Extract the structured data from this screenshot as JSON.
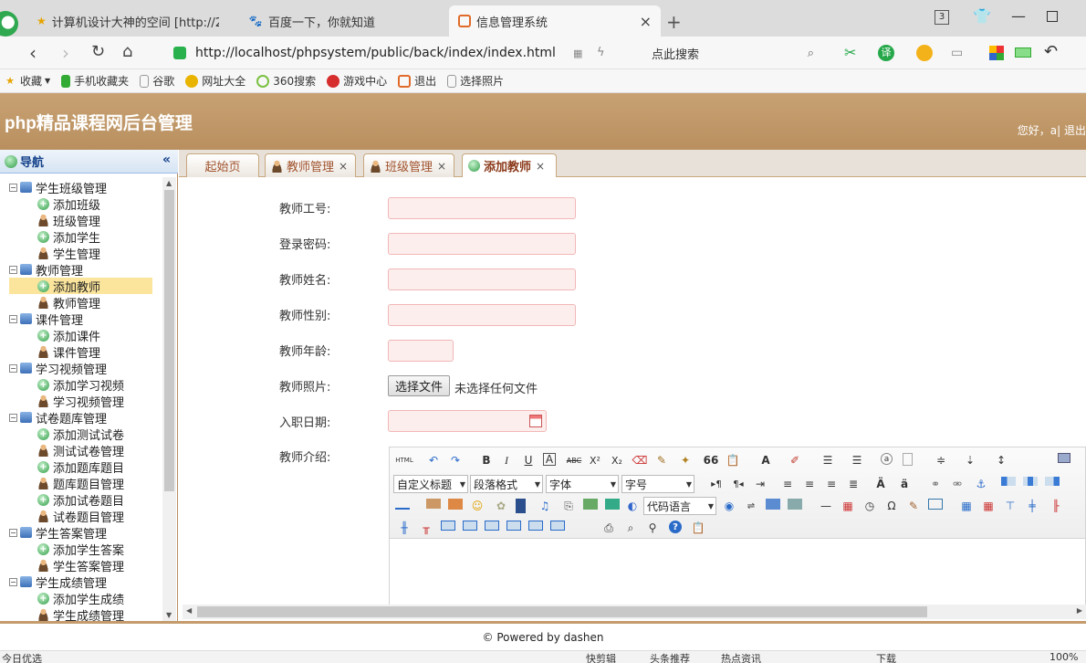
{
  "browser": {
    "tabs": [
      {
        "label": "计算机设计大神的空间 [http://2(",
        "icon": "star-icon",
        "active": false
      },
      {
        "label": "百度一下，你就知道",
        "icon": "baidu-paw-icon",
        "active": false
      },
      {
        "label": "信息管理系统",
        "icon": "site-favicon",
        "active": true
      }
    ],
    "tab_close": "×",
    "new_tab": "+",
    "tab_count": "3",
    "url": "http://localhost/phpsystem/public/back/index/index.html",
    "search_placeholder": "点此搜索",
    "bookmarks": [
      {
        "label": "收藏",
        "icon": "star-icon"
      },
      {
        "label": "手机收藏夹",
        "icon": "phone-icon"
      },
      {
        "label": "谷歌",
        "icon": "page-icon"
      },
      {
        "label": "网址大全",
        "icon": "globe-icon"
      },
      {
        "label": "360搜索",
        "icon": "search-icon"
      },
      {
        "label": "游戏中心",
        "icon": "game-icon"
      },
      {
        "label": "退出",
        "icon": "site-favicon"
      },
      {
        "label": "选择照片",
        "icon": "page-icon"
      }
    ]
  },
  "app": {
    "title": "php精品课程网后台管理",
    "greeting": "您好，a| 退出",
    "sidebar_title": "导航",
    "collapse": "«",
    "tree": [
      {
        "label": "学生班级管理",
        "type": "folder"
      },
      {
        "label": "添加班级",
        "type": "add"
      },
      {
        "label": "班级管理",
        "type": "user"
      },
      {
        "label": "添加学生",
        "type": "add"
      },
      {
        "label": "学生管理",
        "type": "user"
      },
      {
        "label": "教师管理",
        "type": "folder"
      },
      {
        "label": "添加教师",
        "type": "add",
        "selected": true
      },
      {
        "label": "教师管理",
        "type": "user"
      },
      {
        "label": "课件管理",
        "type": "folder"
      },
      {
        "label": "添加课件",
        "type": "add"
      },
      {
        "label": "课件管理",
        "type": "user"
      },
      {
        "label": "学习视频管理",
        "type": "folder"
      },
      {
        "label": "添加学习视频",
        "type": "add"
      },
      {
        "label": "学习视频管理",
        "type": "user"
      },
      {
        "label": "试卷题库管理",
        "type": "folder"
      },
      {
        "label": "添加测试试卷",
        "type": "add"
      },
      {
        "label": "测试试卷管理",
        "type": "user"
      },
      {
        "label": "添加题库题目",
        "type": "add"
      },
      {
        "label": "题库题目管理",
        "type": "user"
      },
      {
        "label": "添加试卷题目",
        "type": "add"
      },
      {
        "label": "试卷题目管理",
        "type": "user"
      },
      {
        "label": "学生答案管理",
        "type": "folder"
      },
      {
        "label": "添加学生答案",
        "type": "add"
      },
      {
        "label": "学生答案管理",
        "type": "user"
      },
      {
        "label": "学生成绩管理",
        "type": "folder"
      },
      {
        "label": "添加学生成绩",
        "type": "add"
      },
      {
        "label": "学生成绩管理",
        "type": "user"
      }
    ],
    "tabs": [
      {
        "label": "起始页",
        "icon": "none",
        "closable": false
      },
      {
        "label": "教师管理",
        "icon": "user-icon",
        "closable": true
      },
      {
        "label": "班级管理",
        "icon": "user-icon",
        "closable": true
      },
      {
        "label": "添加教师",
        "icon": "add-icon",
        "closable": true,
        "active": true
      }
    ],
    "form": {
      "teacher_id_label": "教师工号:",
      "password_label": "登录密码:",
      "name_label": "教师姓名:",
      "gender_label": "教师性别:",
      "age_label": "教师年龄:",
      "photo_label": "教师照片:",
      "photo_button": "选择文件",
      "photo_status": "未选择任何文件",
      "hire_date_label": "入职日期:",
      "intro_label": "教师介绍:"
    },
    "editor": {
      "html_btn": "HTML",
      "bold": "B",
      "italic": "I",
      "underline": "U",
      "font_border": "A",
      "strike": "ABC",
      "sup": "X²",
      "sub": "X₂",
      "quote": "66",
      "font_color": "A",
      "title_select": "自定义标题",
      "para_select": "段落格式",
      "font_select": "字体",
      "size_select": "字号",
      "code_select": "代码语言",
      "omega": "Ω"
    },
    "footer": "© Powered by dashen"
  },
  "statusbar": {
    "left": "今日优选",
    "items": [
      "快剪辑",
      "头条推荐",
      "热点资讯",
      "下载",
      "100%"
    ]
  }
}
